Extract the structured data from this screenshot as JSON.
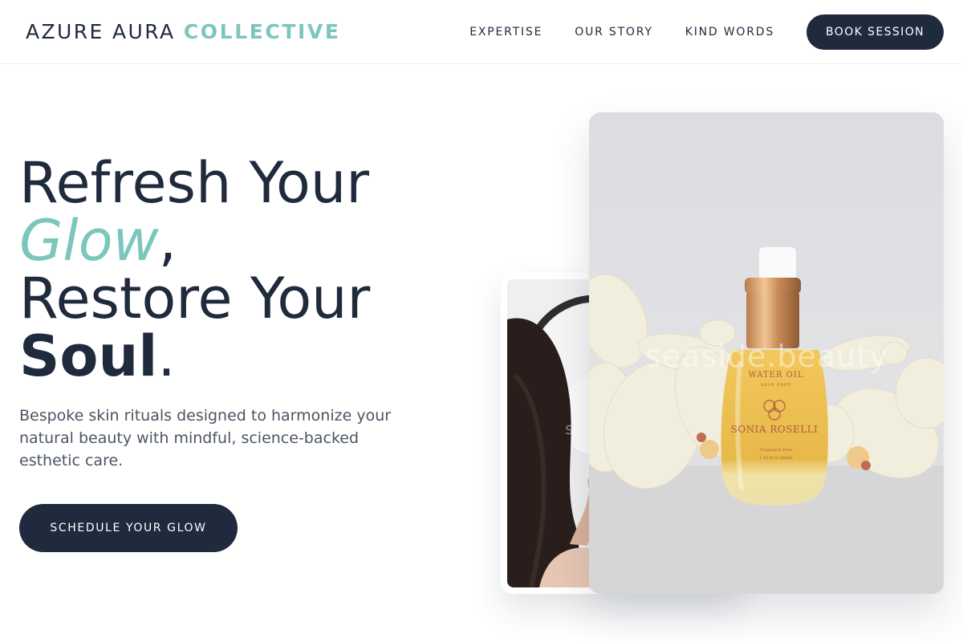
{
  "header": {
    "logo_primary": "AZURE AURA",
    "logo_accent": "COLLECTIVE",
    "nav": [
      {
        "label": "EXPERTISE"
      },
      {
        "label": "OUR STORY"
      },
      {
        "label": "KIND WORDS"
      }
    ],
    "cta_label": "BOOK SESSION"
  },
  "hero": {
    "title_line1": "Refresh Your",
    "title_glow": "Glow",
    "title_comma": ",",
    "title_line3": "Restore Your",
    "title_soul": "Soul",
    "title_period": ".",
    "subtitle": "Bespoke skin rituals designed to harmonize your natural beauty with mindful, science-backed esthetic care.",
    "cta_label": "SCHEDULE YOUR GLOW"
  },
  "images": {
    "main_watermark": "seaside.beauty",
    "secondary_watermark": "se",
    "bottle_brand": "SONIA ROSELLI",
    "bottle_product": "WATER OIL",
    "bottle_sub": "SKIN PREP",
    "bottle_note": "Fragrance Free",
    "bottle_size": "1.52 fl.oz (45ml)"
  },
  "colors": {
    "navy": "#1f2a3d",
    "accent": "#7cc6bd",
    "body_text": "#4b5563"
  }
}
